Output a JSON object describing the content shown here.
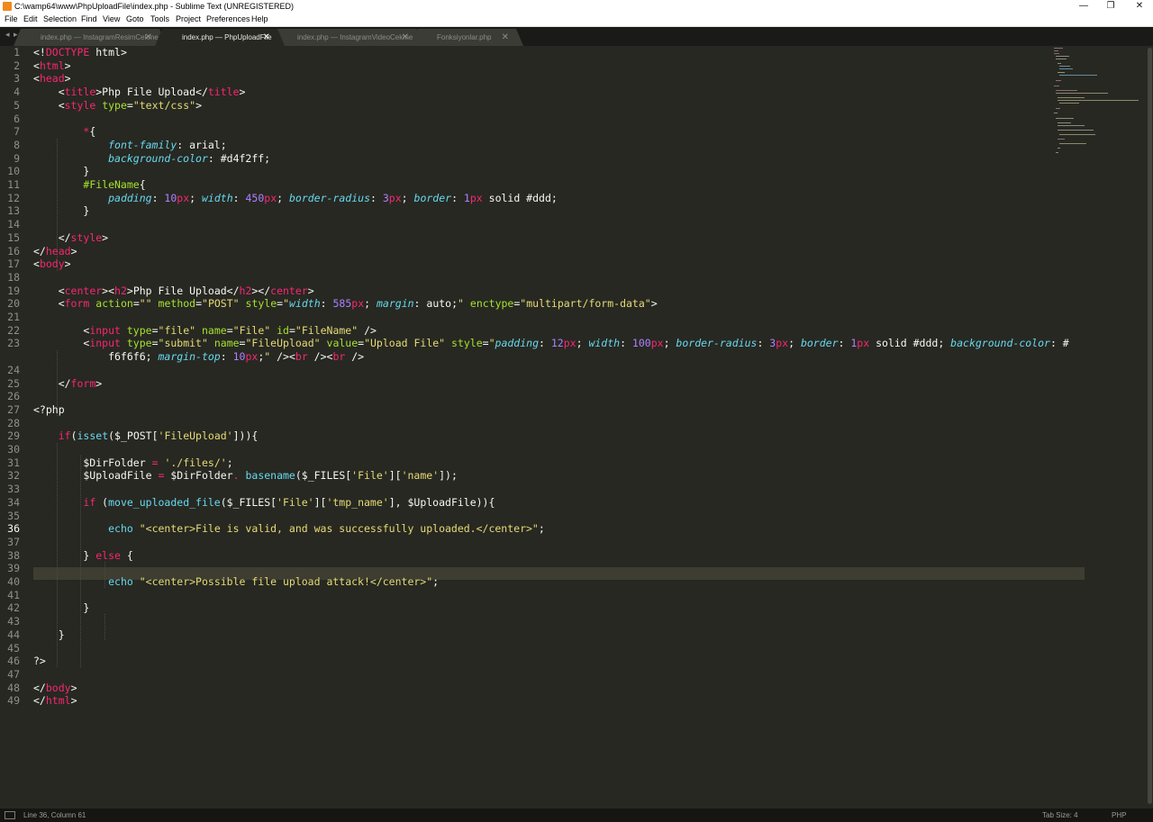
{
  "window": {
    "title": "C:\\wamp64\\www\\PhpUploadFile\\index.php - Sublime Text (UNREGISTERED)",
    "controls": {
      "minimize": "—",
      "maximize": "❐",
      "close": "✕"
    }
  },
  "menu": [
    "File",
    "Edit",
    "Selection",
    "Find",
    "View",
    "Goto",
    "Tools",
    "Project",
    "Preferences",
    "Help"
  ],
  "tab_nav": {
    "back": "◂",
    "forward": "▸"
  },
  "tabs": [
    {
      "label": "index.php — InstagramResimCekme",
      "close": "✕",
      "active": false
    },
    {
      "label": "index.php — PhpUploadFile",
      "close": "✕",
      "active": true
    },
    {
      "label": "index.php — InstagramVideoCekme",
      "close": "✕",
      "active": false
    },
    {
      "label": "Fonksiyonlar.php",
      "close": "✕",
      "active": false
    }
  ],
  "editor": {
    "current_line": 36,
    "line_numbers": [
      "1",
      "2",
      "3",
      "4",
      "5",
      "6",
      "7",
      "8",
      "9",
      "10",
      "11",
      "12",
      "13",
      "14",
      "15",
      "16",
      "17",
      "18",
      "19",
      "20",
      "21",
      "22",
      "23",
      "",
      "24",
      "25",
      "26",
      "27",
      "28",
      "29",
      "30",
      "31",
      "32",
      "33",
      "34",
      "35",
      "36",
      "37",
      "38",
      "39",
      "40",
      "41",
      "42",
      "43",
      "44",
      "45",
      "46",
      "47",
      "48",
      "49"
    ]
  },
  "status": {
    "position": "Line 36, Column 61",
    "tab_size": "Tab Size: 4",
    "syntax": "PHP"
  },
  "colors": {
    "background": "#272822",
    "keyword": "#f92672",
    "attribute": "#a6e22e",
    "string": "#e6db74",
    "property": "#66d9ef",
    "number": "#ae81ff",
    "text": "#f8f8f2"
  }
}
